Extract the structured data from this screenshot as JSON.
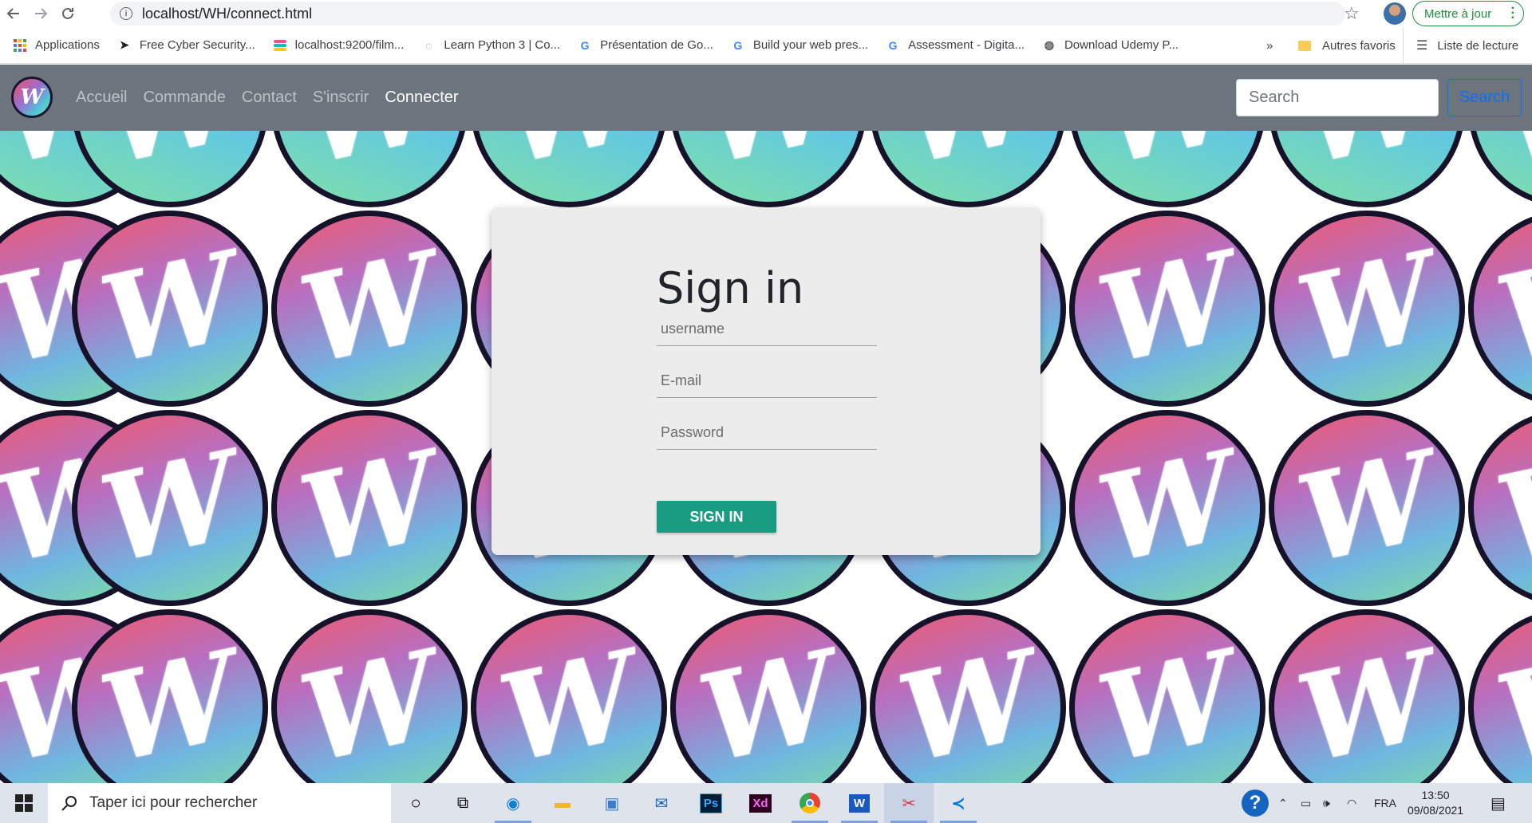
{
  "browser": {
    "url": "localhost/WH/connect.html",
    "update_label": "Mettre à jour",
    "bookmarks": [
      {
        "label": "Applications",
        "icon": "apps-grid-icon"
      },
      {
        "label": "Free Cyber Security...",
        "icon": "cyber-icon"
      },
      {
        "label": "localhost:9200/film...",
        "icon": "elastic-icon"
      },
      {
        "label": "Learn Python 3 | Co...",
        "icon": "loading-icon"
      },
      {
        "label": "Présentation de Go...",
        "icon": "google-icon"
      },
      {
        "label": "Build your web pres...",
        "icon": "google-icon"
      },
      {
        "label": "Assessment - Digita...",
        "icon": "google-icon"
      },
      {
        "label": "Download Udemy P...",
        "icon": "globe-icon"
      }
    ],
    "more_bookmarks": "»",
    "other_favorites": "Autres favoris",
    "reading_list": "Liste de lecture"
  },
  "site": {
    "logo_text": "W",
    "nav": [
      {
        "label": "Accueil",
        "active": false
      },
      {
        "label": "Commande",
        "active": false
      },
      {
        "label": "Contact",
        "active": false
      },
      {
        "label": "S'inscrir",
        "active": false
      },
      {
        "label": "Connecter",
        "active": true
      }
    ],
    "search_placeholder": "Search",
    "search_button": "Search",
    "pattern_letter": "W"
  },
  "signin": {
    "title": "Sign in",
    "username_placeholder": "username",
    "email_placeholder": "E-mail",
    "password_placeholder": "Password",
    "button": "SIGN IN",
    "button_color": "#1a9c82"
  },
  "taskbar": {
    "search_placeholder": "Taper ici pour rechercher",
    "apps": [
      "task-view-icon",
      "edge-icon",
      "file-explorer-icon",
      "store-icon",
      "mail-icon",
      "photoshop-icon",
      "xd-icon",
      "chrome-icon",
      "word-icon",
      "snipping-icon",
      "vscode-icon"
    ],
    "language": "FRA",
    "time": "13:50",
    "date": "09/08/2021"
  }
}
